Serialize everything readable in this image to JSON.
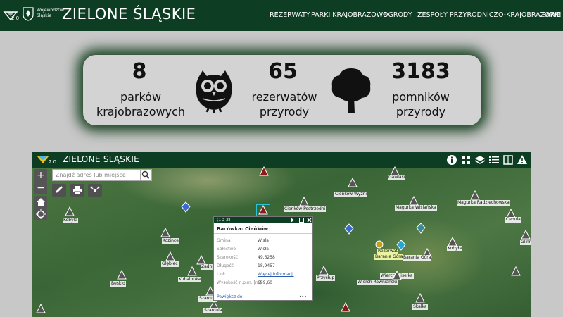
{
  "header": {
    "version": "2.0",
    "region_label": "Województwo Śląskie",
    "brand": "ZIELONE ŚLĄSKIE",
    "nav": [
      "REZERWATY",
      "PARKI KRAJOBRAZOWE",
      "OGRODY",
      "ZESPOŁY PRZYRODNICZO-KRAJOBRAZOWE",
      "PARKI"
    ]
  },
  "stats": {
    "parks": {
      "value": "8",
      "label_1": "parków",
      "label_2": "krajobrazowych"
    },
    "reserves": {
      "value": "65",
      "label_1": "rezerwatów",
      "label_2": "przyrody"
    },
    "monuments": {
      "value": "3183",
      "label_1": "pomników",
      "label_2": "przyrody"
    }
  },
  "map": {
    "title": "ZIELONE ŚLĄSKIE",
    "version": "2.0",
    "search_placeholder": "Znajdź adres lub miejsce",
    "zoom_in": "+",
    "zoom_out": "−",
    "labels": {
      "gawlasi": "Gawlasi",
      "cienkow_wyzni": "Cienków Wyżni",
      "cienkow_postrzedni": "Cienków Postrzedni",
      "magurka_wislanska": "Magurka Wiślańska",
      "magurka_radziechowska": "Magurka Radziechowska",
      "kobyla_1": "Kobyla",
      "kobyla_2": "Kobyła",
      "cebula": "Cebula",
      "kozince": "Kozince",
      "glinne": "Glinne",
      "glebiec": "Głębiec",
      "zadni_gron": "Zadni Groń",
      "kubalonka": "Kubalonka",
      "beskid": "Beskid",
      "szarcula_1": "Szarcula",
      "szarcula_2": "Szarcula",
      "przyslup": "Przysłup",
      "rezerwat": "Rezerwat",
      "barania_gora_1": "Barania Góra",
      "barania_gora_2": "Barania Góra",
      "wierch_wisielka": "Wierch Wisełka",
      "wierch_rownianski": "Wierch Równiański",
      "skalka": "Skałka"
    },
    "popup": {
      "counter": "(1 z 2)",
      "title": "Bacówka: Cieńków",
      "rows": [
        {
          "key": "Gmina",
          "value": "Wisła"
        },
        {
          "key": "Sołectwo",
          "value": "Wisła"
        },
        {
          "key": "Szerokość",
          "value": "49,6258"
        },
        {
          "key": "Długość",
          "value": "18,9457"
        },
        {
          "key": "Link",
          "value": "Więcej informacji"
        },
        {
          "key": "Wysokość n.p.m. [m]",
          "value": "699,60"
        }
      ],
      "zoom_link": "Powiększ do",
      "more": "•••"
    }
  }
}
